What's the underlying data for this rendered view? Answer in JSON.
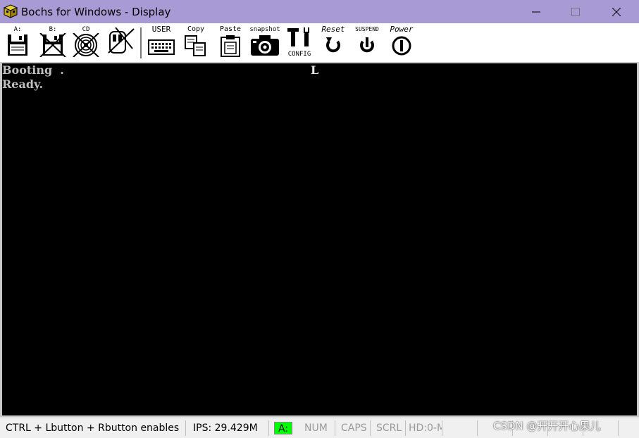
{
  "window": {
    "title": "Bochs for Windows - Display",
    "titlebar_color": "#a89ad4"
  },
  "toolbar": {
    "floppy_a_label": "A:",
    "floppy_b_label": "B:",
    "cdrom_label": "CD",
    "mouse_icon": "mouse-disabled-icon",
    "user_label": "USER",
    "copy_label": "Copy",
    "paste_label": "Paste",
    "snapshot_label": "snapshot",
    "config_label": "CONFIG",
    "reset_label": "Reset",
    "suspend_label": "SUSPEND",
    "power_label": "Power"
  },
  "console": {
    "line1": "Booting  .",
    "line1_extra": "L",
    "line2": "Ready."
  },
  "statusbar": {
    "message": "CTRL + Lbutton + Rbutton enables",
    "ips": "IPS: 29.429M",
    "floppy_indicator": "A:",
    "num": "NUM",
    "caps": "CAPS",
    "scrl": "SCRL",
    "hd": "HD:0-M",
    "floppy_indicator_color": "#00ff00"
  },
  "watermark": "CSDN @开开开心果儿"
}
